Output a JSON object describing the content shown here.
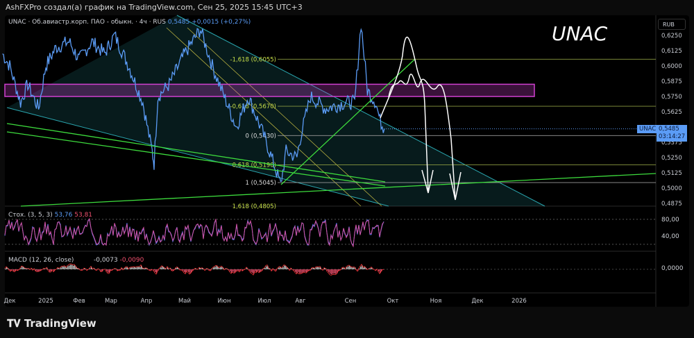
{
  "header": {
    "caption": "AshFXPro создал(а) график на TradingView.com, Сен 25, 2025 15:45 UTC+3"
  },
  "symbol": {
    "legend": "UNAC · Об.авиастр.корп. ПАО - обыкн. · 4ч · RUS",
    "last": "0,5485",
    "change": "+0,0015 (+0,27%)",
    "watermark": "UNAC",
    "tag": "UNAC",
    "price_label": "0,5485",
    "countdown": "03:14:27",
    "currency": "RUB"
  },
  "fib_labels": [
    "-1,618 (0,6055)",
    "-0,618 (0,5670)",
    "0 (0,5430)",
    "0,618 (0,5190)",
    "1 (0,5045)",
    "1,618 (0,4805)"
  ],
  "stoch": {
    "label": "Стох. (3, 5, 3)",
    "k": "53,76",
    "d": "53,81",
    "ticks": [
      "80,00",
      "40,00"
    ]
  },
  "macd": {
    "label": "MACD (12, 26, close)",
    "v1": "-0,0073",
    "v2": "-0,0090",
    "ticks": [
      "0,0000"
    ]
  },
  "brand": {
    "logo": "TradingView"
  },
  "colors": {
    "price": "#5b9cf6",
    "fib": "#c8e04a",
    "zone": "#d040d0",
    "trend": "#3ddc3d",
    "channel": "#2aa7b0"
  },
  "chart_data": {
    "type": "line",
    "title": "UNAC 4h",
    "x_tick_labels": [
      "Дек",
      "2025",
      "Фев",
      "Мар",
      "Апр",
      "Май",
      "Июн",
      "Июл",
      "Авг",
      "Сен",
      "Окт",
      "Ноя",
      "Дек",
      "2026"
    ],
    "y_tick_labels": [
      "0,6250",
      "0,6125",
      "0,6000",
      "0,5875",
      "0,5750",
      "0,5625",
      "0,5375",
      "0,5250",
      "0,5125",
      "0,5000",
      "0,4875"
    ],
    "ylim": [
      0.4875,
      0.625
    ],
    "fib_levels": [
      0.6055,
      0.567,
      0.543,
      0.519,
      0.5045,
      0.4805
    ],
    "resistance_zone": [
      0.575,
      0.585
    ],
    "price_path": [
      [
        -0.2,
        0.61
      ],
      [
        0,
        0.6
      ],
      [
        0.3,
        0.57
      ],
      [
        0.5,
        0.585
      ],
      [
        0.8,
        0.565
      ],
      [
        1.0,
        0.6
      ],
      [
        1.3,
        0.615
      ],
      [
        1.7,
        0.62
      ],
      [
        2.0,
        0.605
      ],
      [
        2.4,
        0.62
      ],
      [
        2.8,
        0.61
      ],
      [
        3.1,
        0.625
      ],
      [
        3.5,
        0.6
      ],
      [
        3.9,
        0.57
      ],
      [
        4.15,
        0.53
      ],
      [
        4.2,
        0.52
      ],
      [
        4.3,
        0.575
      ],
      [
        4.6,
        0.585
      ],
      [
        5.0,
        0.61
      ],
      [
        5.4,
        0.63
      ],
      [
        5.7,
        0.6
      ],
      [
        6.0,
        0.575
      ],
      [
        6.3,
        0.55
      ],
      [
        6.6,
        0.575
      ],
      [
        6.9,
        0.55
      ],
      [
        7.2,
        0.525
      ],
      [
        7.45,
        0.503
      ],
      [
        7.6,
        0.53
      ],
      [
        7.9,
        0.525
      ],
      [
        8.2,
        0.575
      ],
      [
        8.5,
        0.565
      ],
      [
        8.9,
        0.57
      ],
      [
        9.1,
        0.57
      ],
      [
        9.25,
        0.635
      ],
      [
        9.4,
        0.58
      ],
      [
        9.6,
        0.57
      ],
      [
        9.7,
        0.555
      ],
      [
        9.8,
        0.5485
      ]
    ]
  }
}
